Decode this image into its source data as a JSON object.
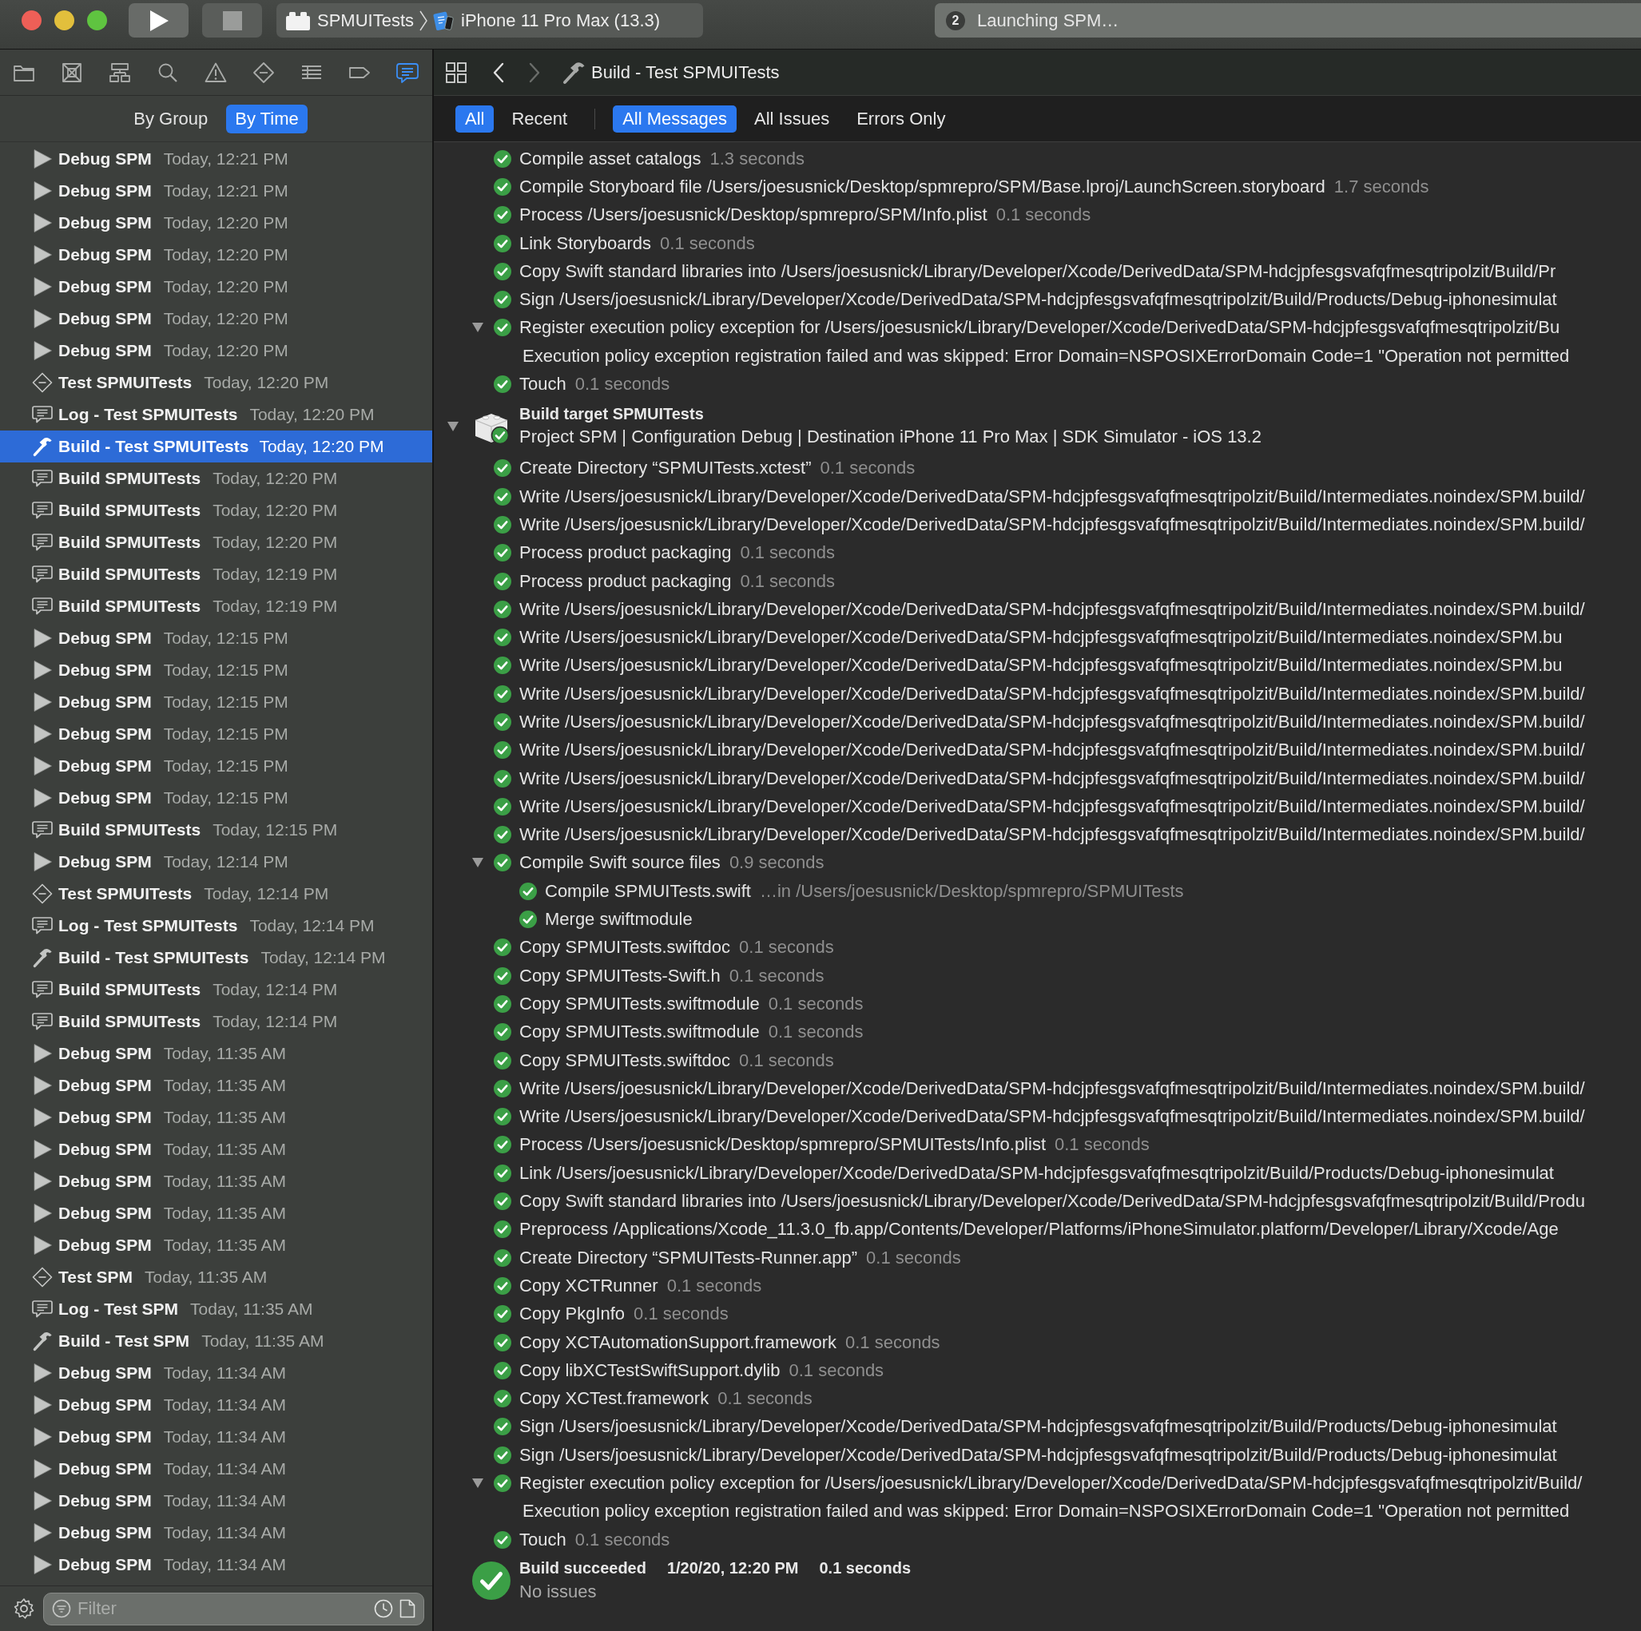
{
  "toolbar": {
    "scheme": {
      "target": "SPMUITests",
      "device": "iPhone 11 Pro Max (13.3)"
    },
    "activity": {
      "count": "2",
      "status": "Launching SPM…"
    }
  },
  "navigator": {
    "tabs": [
      {
        "kind": "project",
        "selected": false
      },
      {
        "kind": "source",
        "selected": false
      },
      {
        "kind": "symbol",
        "selected": false
      },
      {
        "kind": "find",
        "selected": false
      },
      {
        "kind": "issue",
        "selected": false
      },
      {
        "kind": "test",
        "selected": false
      },
      {
        "kind": "debug",
        "selected": false
      },
      {
        "kind": "breakpoint",
        "selected": false
      },
      {
        "kind": "report",
        "selected": true
      }
    ],
    "view_modes": [
      {
        "label": "By Group",
        "selected": false
      },
      {
        "label": "By Time",
        "selected": true
      }
    ],
    "history": [
      {
        "kind": "run",
        "name": "Debug SPM",
        "time": "Today, 12:21 PM",
        "selected": false
      },
      {
        "kind": "run",
        "name": "Debug SPM",
        "time": "Today, 12:21 PM",
        "selected": false
      },
      {
        "kind": "run",
        "name": "Debug SPM",
        "time": "Today, 12:20 PM",
        "selected": false
      },
      {
        "kind": "run",
        "name": "Debug SPM",
        "time": "Today, 12:20 PM",
        "selected": false
      },
      {
        "kind": "run",
        "name": "Debug SPM",
        "time": "Today, 12:20 PM",
        "selected": false
      },
      {
        "kind": "run",
        "name": "Debug SPM",
        "time": "Today, 12:20 PM",
        "selected": false
      },
      {
        "kind": "run",
        "name": "Debug SPM",
        "time": "Today, 12:20 PM",
        "selected": false
      },
      {
        "kind": "test",
        "name": "Test SPMUITests",
        "time": "Today, 12:20 PM",
        "selected": false
      },
      {
        "kind": "log",
        "name": "Log - Test SPMUITests",
        "time": "Today, 12:20 PM",
        "selected": false
      },
      {
        "kind": "build",
        "name": "Build - Test SPMUITests",
        "time": "Today, 12:20 PM",
        "selected": true
      },
      {
        "kind": "log",
        "name": "Build SPMUITests",
        "time": "Today, 12:20 PM",
        "selected": false
      },
      {
        "kind": "log",
        "name": "Build SPMUITests",
        "time": "Today, 12:20 PM",
        "selected": false
      },
      {
        "kind": "log",
        "name": "Build SPMUITests",
        "time": "Today, 12:20 PM",
        "selected": false
      },
      {
        "kind": "log",
        "name": "Build SPMUITests",
        "time": "Today, 12:19 PM",
        "selected": false
      },
      {
        "kind": "log",
        "name": "Build SPMUITests",
        "time": "Today, 12:19 PM",
        "selected": false
      },
      {
        "kind": "run",
        "name": "Debug SPM",
        "time": "Today, 12:15 PM",
        "selected": false
      },
      {
        "kind": "run",
        "name": "Debug SPM",
        "time": "Today, 12:15 PM",
        "selected": false
      },
      {
        "kind": "run",
        "name": "Debug SPM",
        "time": "Today, 12:15 PM",
        "selected": false
      },
      {
        "kind": "run",
        "name": "Debug SPM",
        "time": "Today, 12:15 PM",
        "selected": false
      },
      {
        "kind": "run",
        "name": "Debug SPM",
        "time": "Today, 12:15 PM",
        "selected": false
      },
      {
        "kind": "run",
        "name": "Debug SPM",
        "time": "Today, 12:15 PM",
        "selected": false
      },
      {
        "kind": "log",
        "name": "Build SPMUITests",
        "time": "Today, 12:15 PM",
        "selected": false
      },
      {
        "kind": "run",
        "name": "Debug SPM",
        "time": "Today, 12:14 PM",
        "selected": false
      },
      {
        "kind": "test",
        "name": "Test SPMUITests",
        "time": "Today, 12:14 PM",
        "selected": false
      },
      {
        "kind": "log",
        "name": "Log - Test SPMUITests",
        "time": "Today, 12:14 PM",
        "selected": false
      },
      {
        "kind": "build",
        "name": "Build - Test SPMUITests",
        "time": "Today, 12:14 PM",
        "selected": false
      },
      {
        "kind": "log",
        "name": "Build SPMUITests",
        "time": "Today, 12:14 PM",
        "selected": false
      },
      {
        "kind": "log",
        "name": "Build SPMUITests",
        "time": "Today, 12:14 PM",
        "selected": false
      },
      {
        "kind": "run",
        "name": "Debug SPM",
        "time": "Today, 11:35 AM",
        "selected": false
      },
      {
        "kind": "run",
        "name": "Debug SPM",
        "time": "Today, 11:35 AM",
        "selected": false
      },
      {
        "kind": "run",
        "name": "Debug SPM",
        "time": "Today, 11:35 AM",
        "selected": false
      },
      {
        "kind": "run",
        "name": "Debug SPM",
        "time": "Today, 11:35 AM",
        "selected": false
      },
      {
        "kind": "run",
        "name": "Debug SPM",
        "time": "Today, 11:35 AM",
        "selected": false
      },
      {
        "kind": "run",
        "name": "Debug SPM",
        "time": "Today, 11:35 AM",
        "selected": false
      },
      {
        "kind": "run",
        "name": "Debug SPM",
        "time": "Today, 11:35 AM",
        "selected": false
      },
      {
        "kind": "test",
        "name": "Test SPM",
        "time": "Today, 11:35 AM",
        "selected": false
      },
      {
        "kind": "log",
        "name": "Log - Test SPM",
        "time": "Today, 11:35 AM",
        "selected": false
      },
      {
        "kind": "build",
        "name": "Build - Test SPM",
        "time": "Today, 11:35 AM",
        "selected": false
      },
      {
        "kind": "run",
        "name": "Debug SPM",
        "time": "Today, 11:34 AM",
        "selected": false
      },
      {
        "kind": "run",
        "name": "Debug SPM",
        "time": "Today, 11:34 AM",
        "selected": false
      },
      {
        "kind": "run",
        "name": "Debug SPM",
        "time": "Today, 11:34 AM",
        "selected": false
      },
      {
        "kind": "run",
        "name": "Debug SPM",
        "time": "Today, 11:34 AM",
        "selected": false
      },
      {
        "kind": "run",
        "name": "Debug SPM",
        "time": "Today, 11:34 AM",
        "selected": false
      },
      {
        "kind": "run",
        "name": "Debug SPM",
        "time": "Today, 11:34 AM",
        "selected": false
      },
      {
        "kind": "run",
        "name": "Debug SPM",
        "time": "Today, 11:34 AM",
        "selected": false
      }
    ],
    "filter": {
      "placeholder": "Filter"
    }
  },
  "editor": {
    "jump_bar": {
      "navigation": [
        {
          "kind": "back",
          "disabled": false
        },
        {
          "kind": "forward",
          "disabled": true
        }
      ],
      "path": [
        "Build - Test SPMUITests"
      ]
    },
    "scope_filters": [
      {
        "label": "All",
        "selected": true
      },
      {
        "label": "Recent",
        "selected": false
      }
    ],
    "message_filters": [
      {
        "label": "All Messages",
        "selected": true
      },
      {
        "label": "All Issues",
        "selected": false
      },
      {
        "label": "Errors Only",
        "selected": false
      }
    ],
    "log": {
      "steps": [
        {
          "kind": "step",
          "succeeded": true,
          "text": "Compile asset catalogs",
          "duration": "1.3 seconds"
        },
        {
          "kind": "step",
          "succeeded": true,
          "text": "Compile Storyboard file /Users/joesusnick/Desktop/spmrepro/SPM/Base.lproj/LaunchScreen.storyboard",
          "duration": "1.7 seconds"
        },
        {
          "kind": "step",
          "succeeded": true,
          "text": "Process /Users/joesusnick/Desktop/spmrepro/SPM/Info.plist",
          "duration": "0.1 seconds"
        },
        {
          "kind": "step",
          "succeeded": true,
          "text": "Link Storyboards",
          "duration": "0.1 seconds"
        },
        {
          "kind": "step",
          "succeeded": true,
          "text": "Copy Swift standard libraries into /Users/joesusnick/Library/Developer/Xcode/DerivedData/SPM-hdcjpfesgsvafqfmesqtripolzit/Build/Pr"
        },
        {
          "kind": "step",
          "succeeded": true,
          "text": "Sign /Users/joesusnick/Library/Developer/Xcode/DerivedData/SPM-hdcjpfesgsvafqfmesqtripolzit/Build/Products/Debug-iphonesimulat"
        },
        {
          "kind": "step",
          "succeeded": true,
          "text": "Register execution policy exception for /Users/joesusnick/Library/Developer/Xcode/DerivedData/SPM-hdcjpfesgsvafqfmesqtripolzit/Bu",
          "expanded": true,
          "children": [
            {
              "kind": "message",
              "text": "Execution policy exception registration failed and was skipped: Error Domain=NSPOSIXErrorDomain Code=1 \"Operation not permitted"
            }
          ]
        },
        {
          "kind": "step",
          "succeeded": true,
          "text": "Touch",
          "duration": "0.1 seconds"
        }
      ],
      "target": {
        "title": "Build target SPMUITests",
        "details": "Project SPM | Configuration Debug | Destination iPhone 11 Pro Max | SDK Simulator - iOS 13.2",
        "succeeded": true,
        "expanded": true,
        "children": [
          {
            "kind": "step",
            "succeeded": true,
            "text": "Create Directory “SPMUITests.xctest”",
            "duration": "0.1 seconds"
          },
          {
            "kind": "step",
            "succeeded": true,
            "text": "Write /Users/joesusnick/Library/Developer/Xcode/DerivedData/SPM-hdcjpfesgsvafqfmesqtripolzit/Build/Intermediates.noindex/SPM.build/"
          },
          {
            "kind": "step",
            "succeeded": true,
            "text": "Write /Users/joesusnick/Library/Developer/Xcode/DerivedData/SPM-hdcjpfesgsvafqfmesqtripolzit/Build/Intermediates.noindex/SPM.build/"
          },
          {
            "kind": "step",
            "succeeded": true,
            "text": "Process product packaging",
            "duration": "0.1 seconds"
          },
          {
            "kind": "step",
            "succeeded": true,
            "text": "Process product packaging",
            "duration": "0.1 seconds"
          },
          {
            "kind": "step",
            "succeeded": true,
            "text": "Write /Users/joesusnick/Library/Developer/Xcode/DerivedData/SPM-hdcjpfesgsvafqfmesqtripolzit/Build/Intermediates.noindex/SPM.build/"
          },
          {
            "kind": "step",
            "succeeded": true,
            "text": "Write /Users/joesusnick/Library/Developer/Xcode/DerivedData/SPM-hdcjpfesgsvafqfmesqtripolzit/Build/Intermediates.noindex/SPM.bu"
          },
          {
            "kind": "step",
            "succeeded": true,
            "text": "Write /Users/joesusnick/Library/Developer/Xcode/DerivedData/SPM-hdcjpfesgsvafqfmesqtripolzit/Build/Intermediates.noindex/SPM.bu"
          },
          {
            "kind": "step",
            "succeeded": true,
            "text": "Write /Users/joesusnick/Library/Developer/Xcode/DerivedData/SPM-hdcjpfesgsvafqfmesqtripolzit/Build/Intermediates.noindex/SPM.build/"
          },
          {
            "kind": "step",
            "succeeded": true,
            "text": "Write /Users/joesusnick/Library/Developer/Xcode/DerivedData/SPM-hdcjpfesgsvafqfmesqtripolzit/Build/Intermediates.noindex/SPM.build/"
          },
          {
            "kind": "step",
            "succeeded": true,
            "text": "Write /Users/joesusnick/Library/Developer/Xcode/DerivedData/SPM-hdcjpfesgsvafqfmesqtripolzit/Build/Intermediates.noindex/SPM.build/"
          },
          {
            "kind": "step",
            "succeeded": true,
            "text": "Write /Users/joesusnick/Library/Developer/Xcode/DerivedData/SPM-hdcjpfesgsvafqfmesqtripolzit/Build/Intermediates.noindex/SPM.build/"
          },
          {
            "kind": "step",
            "succeeded": true,
            "text": "Write /Users/joesusnick/Library/Developer/Xcode/DerivedData/SPM-hdcjpfesgsvafqfmesqtripolzit/Build/Intermediates.noindex/SPM.build/"
          },
          {
            "kind": "step",
            "succeeded": true,
            "text": "Write /Users/joesusnick/Library/Developer/Xcode/DerivedData/SPM-hdcjpfesgsvafqfmesqtripolzit/Build/Intermediates.noindex/SPM.build/"
          },
          {
            "kind": "step",
            "succeeded": true,
            "text": "Compile Swift source files",
            "duration": "0.9 seconds",
            "expanded": true,
            "children": [
              {
                "kind": "step",
                "succeeded": true,
                "text": "Compile SPMUITests.swift",
                "detail": "…in /Users/joesusnick/Desktop/spmrepro/SPMUITests"
              },
              {
                "kind": "step",
                "succeeded": true,
                "text": "Merge swiftmodule"
              }
            ]
          },
          {
            "kind": "step",
            "succeeded": true,
            "text": "Copy SPMUITests.swiftdoc",
            "duration": "0.1 seconds"
          },
          {
            "kind": "step",
            "succeeded": true,
            "text": "Copy SPMUITests-Swift.h",
            "duration": "0.1 seconds"
          },
          {
            "kind": "step",
            "succeeded": true,
            "text": "Copy SPMUITests.swiftmodule",
            "duration": "0.1 seconds"
          },
          {
            "kind": "step",
            "succeeded": true,
            "text": "Copy SPMUITests.swiftmodule",
            "duration": "0.1 seconds"
          },
          {
            "kind": "step",
            "succeeded": true,
            "text": "Copy SPMUITests.swiftdoc",
            "duration": "0.1 seconds"
          },
          {
            "kind": "step",
            "succeeded": true,
            "text": "Write /Users/joesusnick/Library/Developer/Xcode/DerivedData/SPM-hdcjpfesgsvafqfmesqtripolzit/Build/Intermediates.noindex/SPM.build/"
          },
          {
            "kind": "step",
            "succeeded": true,
            "text": "Write /Users/joesusnick/Library/Developer/Xcode/DerivedData/SPM-hdcjpfesgsvafqfmesqtripolzit/Build/Intermediates.noindex/SPM.build/"
          },
          {
            "kind": "step",
            "succeeded": true,
            "text": "Process /Users/joesusnick/Desktop/spmrepro/SPMUITests/Info.plist",
            "duration": "0.1 seconds"
          },
          {
            "kind": "step",
            "succeeded": true,
            "text": "Link /Users/joesusnick/Library/Developer/Xcode/DerivedData/SPM-hdcjpfesgsvafqfmesqtripolzit/Build/Products/Debug-iphonesimulat"
          },
          {
            "kind": "step",
            "succeeded": true,
            "text": "Copy Swift standard libraries into /Users/joesusnick/Library/Developer/Xcode/DerivedData/SPM-hdcjpfesgsvafqfmesqtripolzit/Build/Produ"
          },
          {
            "kind": "step",
            "succeeded": true,
            "text": "Preprocess /Applications/Xcode_11.3.0_fb.app/Contents/Developer/Platforms/iPhoneSimulator.platform/Developer/Library/Xcode/Age"
          },
          {
            "kind": "step",
            "succeeded": true,
            "text": "Create Directory “SPMUITests-Runner.app”",
            "duration": "0.1 seconds"
          },
          {
            "kind": "step",
            "succeeded": true,
            "text": "Copy XCTRunner",
            "duration": "0.1 seconds"
          },
          {
            "kind": "step",
            "succeeded": true,
            "text": "Copy PkgInfo",
            "duration": "0.1 seconds"
          },
          {
            "kind": "step",
            "succeeded": true,
            "text": "Copy XCTAutomationSupport.framework",
            "duration": "0.1 seconds"
          },
          {
            "kind": "step",
            "succeeded": true,
            "text": "Copy libXCTestSwiftSupport.dylib",
            "duration": "0.1 seconds"
          },
          {
            "kind": "step",
            "succeeded": true,
            "text": "Copy XCTest.framework",
            "duration": "0.1 seconds"
          },
          {
            "kind": "step",
            "succeeded": true,
            "text": "Sign /Users/joesusnick/Library/Developer/Xcode/DerivedData/SPM-hdcjpfesgsvafqfmesqtripolzit/Build/Products/Debug-iphonesimulat"
          },
          {
            "kind": "step",
            "succeeded": true,
            "text": "Sign /Users/joesusnick/Library/Developer/Xcode/DerivedData/SPM-hdcjpfesgsvafqfmesqtripolzit/Build/Products/Debug-iphonesimulat"
          },
          {
            "kind": "step",
            "succeeded": true,
            "text": "Register execution policy exception for /Users/joesusnick/Library/Developer/Xcode/DerivedData/SPM-hdcjpfesgsvafqfmesqtripolzit/Build/",
            "expanded": true,
            "children": [
              {
                "kind": "message",
                "text": "Execution policy exception registration failed and was skipped: Error Domain=NSPOSIXErrorDomain Code=1 \"Operation not permitted"
              }
            ]
          },
          {
            "kind": "step",
            "succeeded": true,
            "text": "Touch",
            "duration": "0.1 seconds"
          }
        ]
      },
      "result": {
        "succeeded": true,
        "title": "Build succeeded",
        "date": "1/20/20, 12:20 PM",
        "duration": "0.1 seconds",
        "summary": "No issues"
      }
    }
  }
}
